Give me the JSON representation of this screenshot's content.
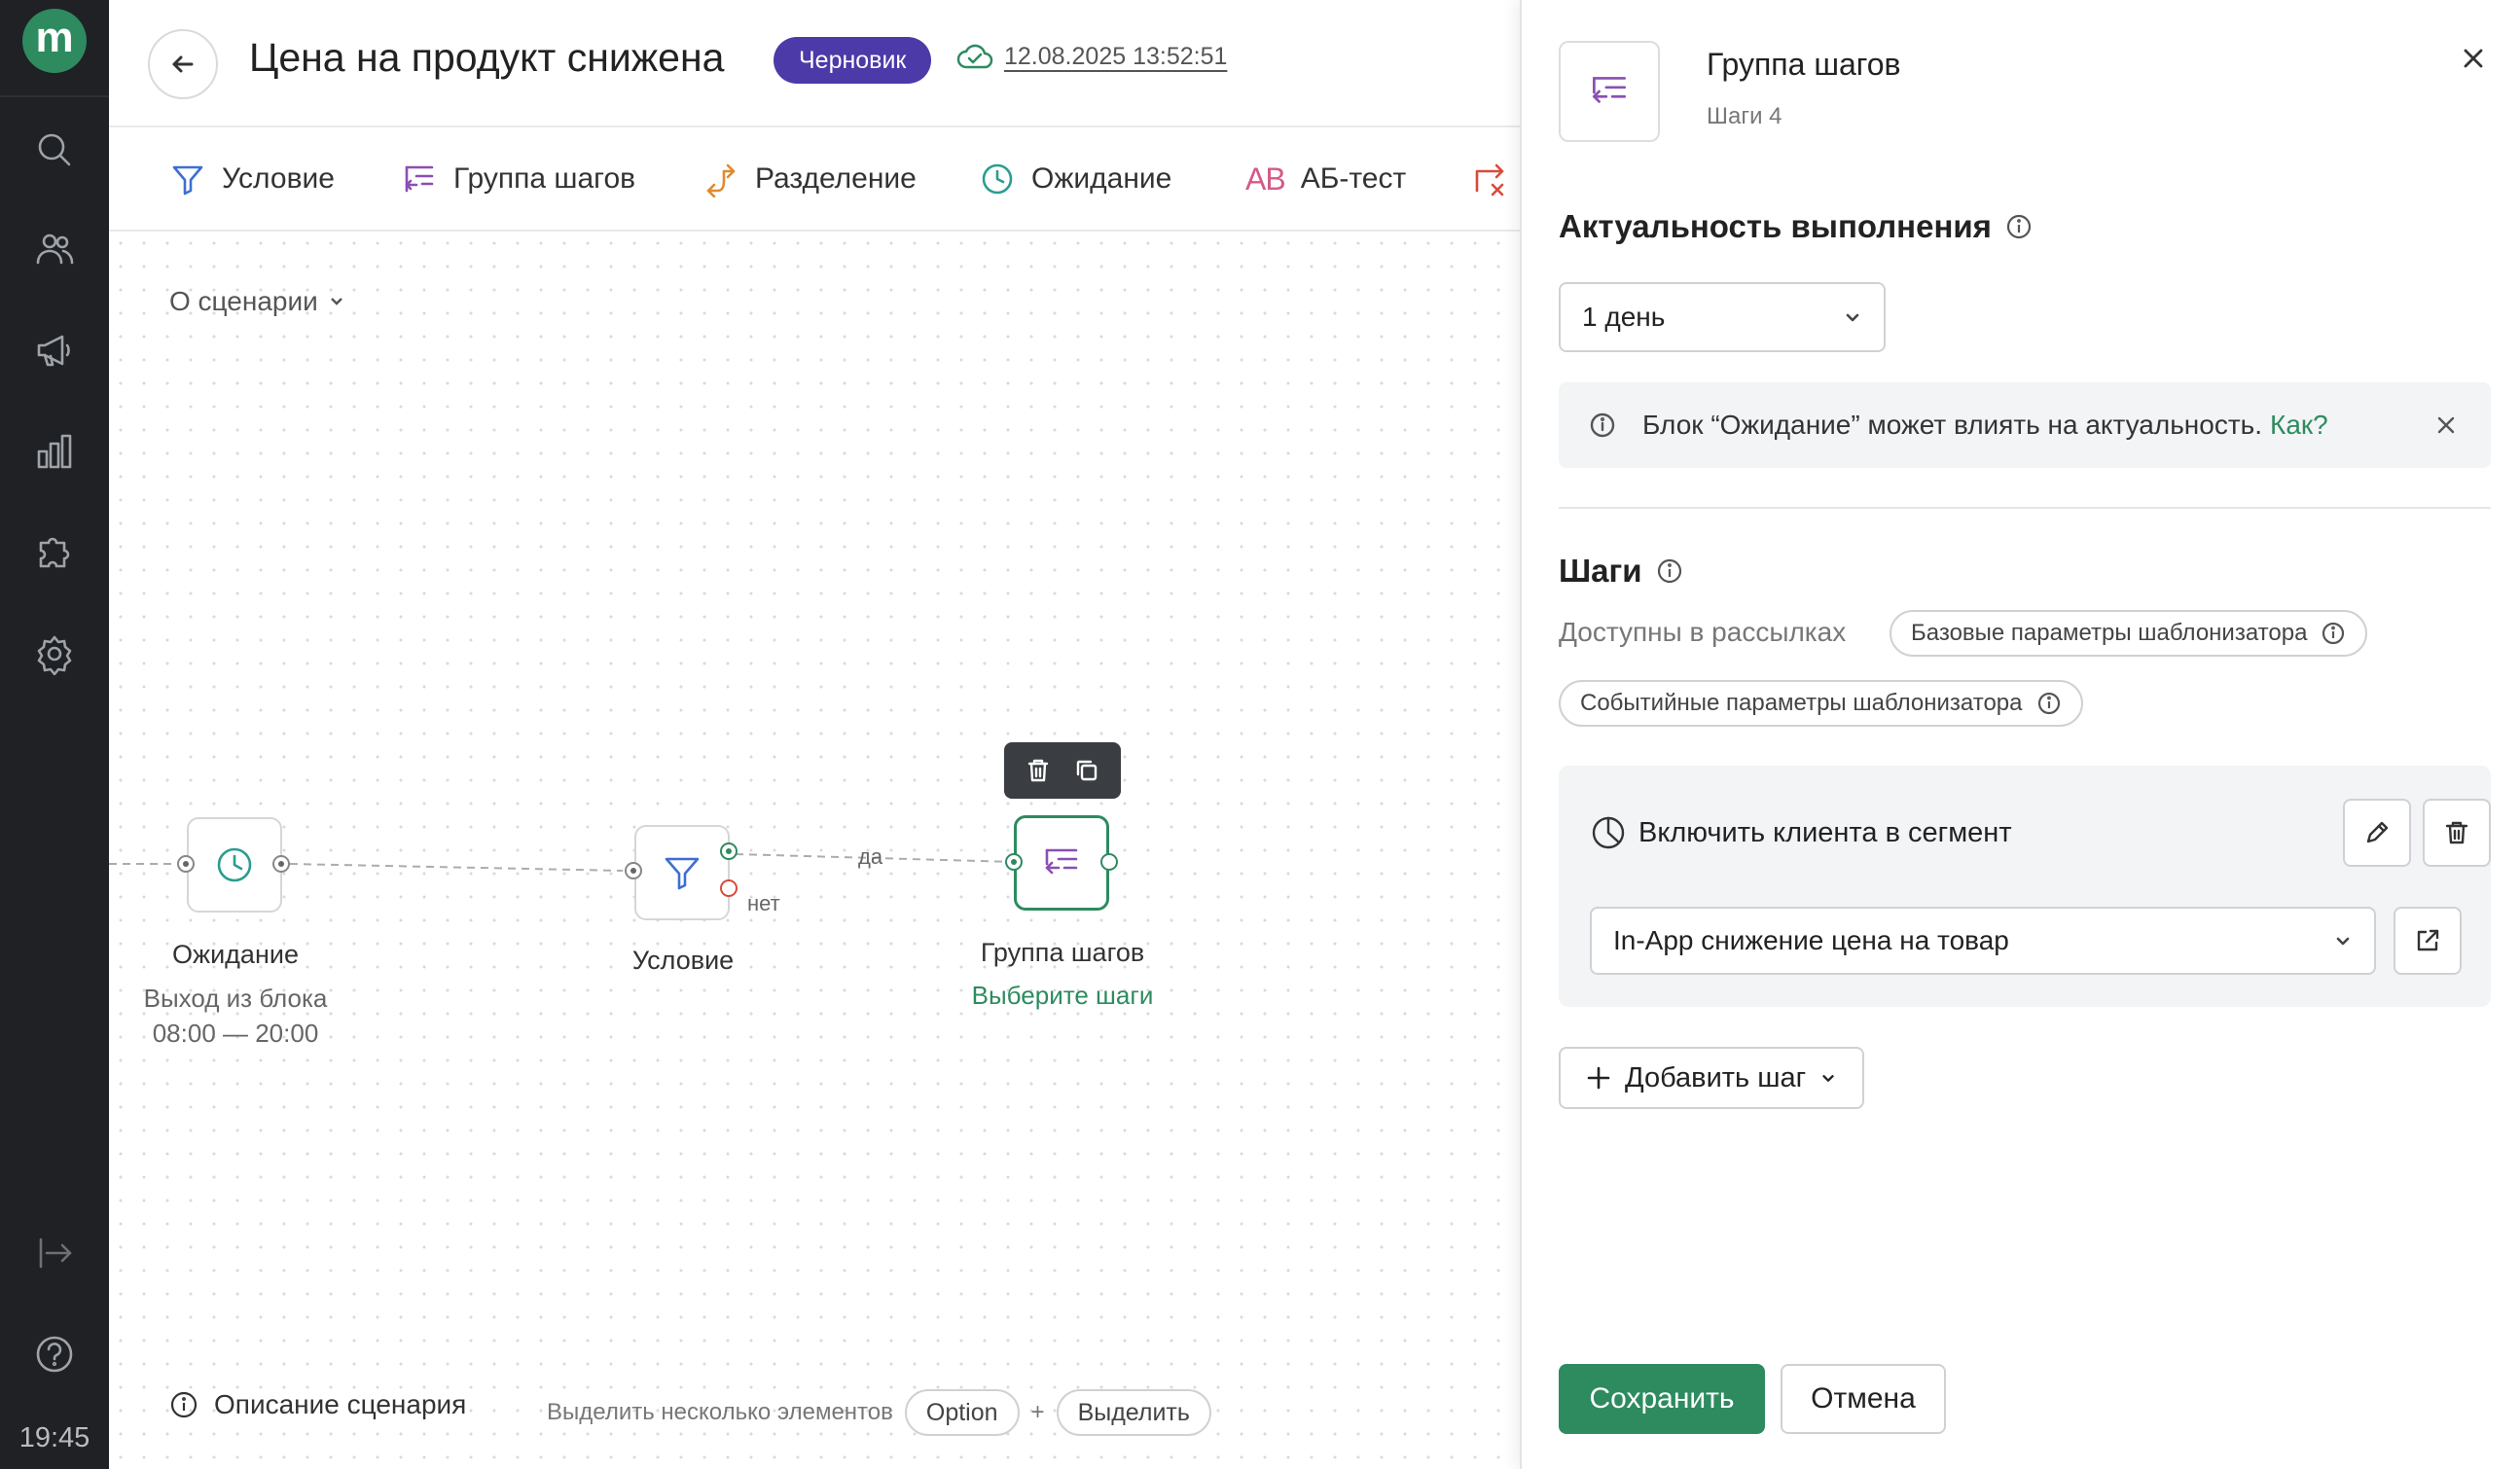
{
  "sidebar": {
    "logo_letter": "m",
    "icons": [
      "search-icon",
      "users-icon",
      "megaphone-icon",
      "analytics-icon",
      "puzzle-icon",
      "settings-icon",
      "exit-icon",
      "help-icon"
    ],
    "time": "19:45"
  },
  "header": {
    "title": "Цена на продукт снижена",
    "badge": "Черновик",
    "saved_at": "12.08.2025 13:52:51"
  },
  "toolbar": {
    "items": [
      {
        "label": "Условие",
        "icon": "filter-icon",
        "color": "#3d6fd1"
      },
      {
        "label": "Группа шагов",
        "icon": "step-group-icon",
        "color": "#8a4fb3"
      },
      {
        "label": "Разделение",
        "icon": "split-icon",
        "color": "#e08a2d"
      },
      {
        "label": "Ожидание",
        "icon": "clock-icon",
        "color": "#2a9d8f"
      },
      {
        "label": "АБ-тест",
        "icon": "ab-icon",
        "icon_text": "AB",
        "color": "#d45a8a"
      }
    ]
  },
  "canvas": {
    "about": "О сценарии",
    "nodes": {
      "wait": {
        "label": "Ожидание",
        "sub1": "Выход из блока",
        "sub2": "08:00 — 20:00"
      },
      "condition": {
        "label": "Условие"
      },
      "group": {
        "label": "Группа шагов",
        "link": "Выберите шаги"
      }
    },
    "edges": {
      "yes": "да",
      "no": "нет"
    },
    "footer": {
      "description": "Описание сценария",
      "hint": "Выделить несколько элементов",
      "key1": "Option",
      "plus": "+",
      "key2": "Выделить"
    }
  },
  "panel": {
    "title": "Группа шагов",
    "subtitle": "Шаги 4",
    "relevance": {
      "title": "Актуальность выполнения",
      "value": "1 день",
      "notice_text": "Блок “Ожидание” может влиять на актуальность.",
      "notice_link": "Как?"
    },
    "steps": {
      "title": "Шаги",
      "available_label": "Доступны в рассылках",
      "chips": [
        "Базовые параметры шаблонизатора",
        "Событийные параметры шаблонизатора"
      ],
      "card": {
        "title": "Включить клиента в сегмент",
        "segment_value": "In-App снижение цена на товар"
      },
      "add_label": "Добавить шаг"
    },
    "save_label": "Сохранить",
    "cancel_label": "Отмена"
  },
  "colors": {
    "accent": "#2e8b5f",
    "badge": "#4b3aa8",
    "sidebar": "#1f2124"
  }
}
